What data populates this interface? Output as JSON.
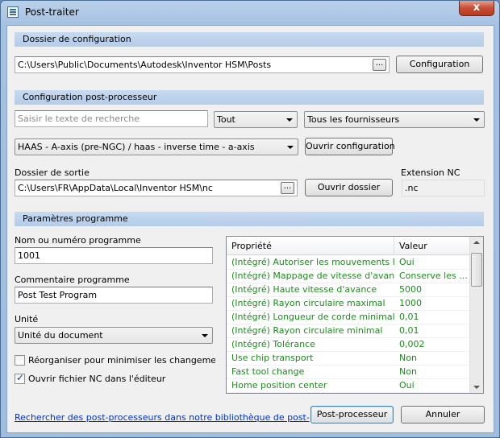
{
  "window": {
    "title": "Post-traiter",
    "close_glyph": "x"
  },
  "config_folder": {
    "header": "Dossier de configuration",
    "path": "C:\\Users\\Public\\Documents\\Autodesk\\Inventor HSM\\Posts",
    "browse_label": "...",
    "config_button": "Configuration"
  },
  "post_config": {
    "header": "Configuration post-processeur",
    "search_placeholder": "Saisir le texte de recherche",
    "filter_type": "Tout",
    "filter_vendor": "Tous les fournisseurs",
    "post_selected": "HAAS - A-axis (pre-NGC) / haas - inverse time - a-axis",
    "open_config_button": "Ouvrir configuration"
  },
  "output": {
    "folder_label": "Dossier de sortie",
    "folder_path": "C:\\Users\\FR\\AppData\\Local\\Inventor HSM\\nc",
    "browse_label": "...",
    "open_folder_button": "Ouvrir dossier",
    "extension_label": "Extension NC",
    "extension_value": ".nc"
  },
  "program": {
    "header": "Paramètres programme",
    "name_label": "Nom ou numéro programme",
    "name_value": "1001",
    "comment_label": "Commentaire programme",
    "comment_value": "Post Test Program",
    "unit_label": "Unité",
    "unit_value": "Unité du document",
    "reorganize_label": "Réorganiser pour minimiser les changements d'ou",
    "reorganize_checked": false,
    "open_nc_label": "Ouvrir fichier NC dans l'éditeur",
    "open_nc_checked": true
  },
  "properties": {
    "col_property": "Propriété",
    "col_value": "Valeur",
    "value_color": "#1e8a1e",
    "rows": [
      {
        "property": "(Intégré) Autoriser les mouvements héli...",
        "value": "Oui"
      },
      {
        "property": "(Intégré) Mappage de vitesse d'avance...",
        "value": "Conserve les ..."
      },
      {
        "property": "(Intégré) Haute vitesse d'avance",
        "value": "5000"
      },
      {
        "property": "(Intégré) Rayon circulaire maximal",
        "value": "1000"
      },
      {
        "property": "(Intégré) Longueur de corde minimale",
        "value": "0,01"
      },
      {
        "property": "(Intégré) Rayon circulaire minimal",
        "value": "0,01"
      },
      {
        "property": "(Intégré) Tolérance",
        "value": "0,002"
      },
      {
        "property": "Use chip transport",
        "value": "Non"
      },
      {
        "property": "Fast tool change",
        "value": "Non"
      },
      {
        "property": "Home position center",
        "value": "Oui"
      }
    ]
  },
  "footer": {
    "library_link": "Rechercher des post-processeurs dans notre bibliothèque de post-processeurs",
    "post_button": "Post-processeur",
    "cancel_button": "Annuler"
  }
}
